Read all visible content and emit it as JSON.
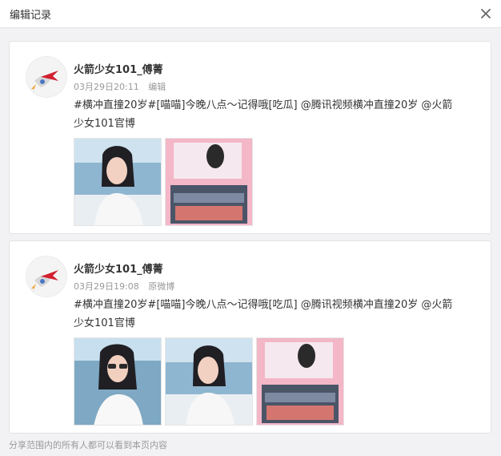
{
  "header": {
    "title": "编辑记录"
  },
  "icons": {
    "close": "close-icon",
    "avatar": "rocket-flag-logo"
  },
  "records": [
    {
      "name": "火箭少女101_傅菁",
      "time": "03月29日20:11",
      "tag": "编辑",
      "text_line1": "#横冲直撞20岁#[喵喵]今晚八点～记得哦[吃瓜] @腾讯视频横冲直撞20岁 @火箭",
      "text_line2": "少女101官博",
      "images": [
        "girl-photo",
        "poster-photo"
      ]
    },
    {
      "name": "火箭少女101_傅菁",
      "time": "03月29日19:08",
      "tag": "原微博",
      "text_line1": "#横冲直撞20岁#[喵喵]今晚八点～记得哦[吃瓜] @腾讯视频横冲直撞20岁 @火箭",
      "text_line2": "少女101官博",
      "images": [
        "girl-sunglasses-photo",
        "girl-photo",
        "poster-photo"
      ]
    }
  ],
  "footer": {
    "text": "分享范围内的所有人都可以看到本页内容"
  }
}
